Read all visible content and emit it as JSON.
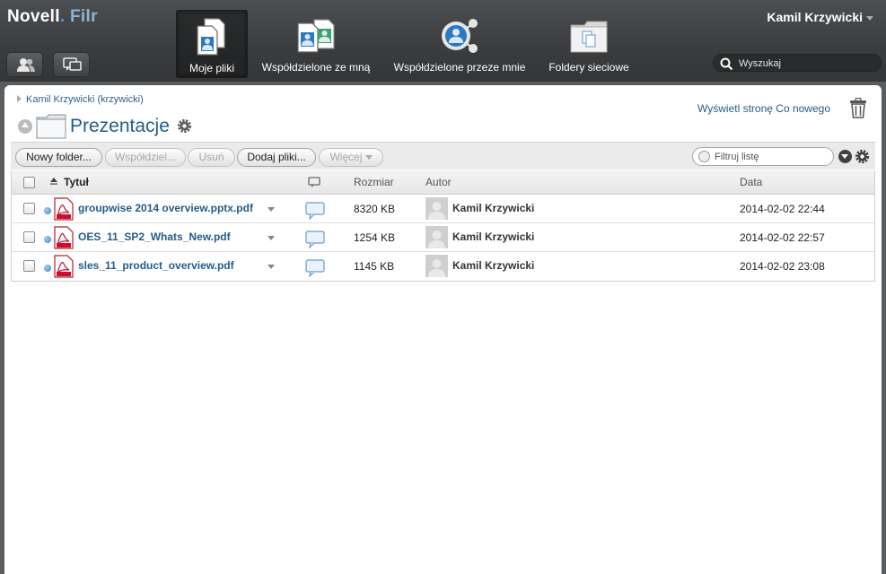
{
  "app": {
    "brand": "Novell",
    "brand_product": "Filr"
  },
  "user": {
    "name": "Kamil Krzywicki"
  },
  "nav": {
    "tabs": [
      {
        "label": "Moje pliki",
        "active": true
      },
      {
        "label": "Współdzielone ze mną",
        "active": false
      },
      {
        "label": "Współdzielone przeze mnie",
        "active": false
      },
      {
        "label": "Foldery sieciowe",
        "active": false
      }
    ]
  },
  "search": {
    "placeholder": "Wyszukaj"
  },
  "breadcrumb": {
    "label": "Kamil Krzywicki (krzywicki)"
  },
  "folder": {
    "title": "Prezentacje"
  },
  "whats_new_label": "Wyświetl stronę Co nowego",
  "toolbar": {
    "new_folder": "Nowy folder...",
    "share": "Współdziel...",
    "delete": "Usuń",
    "add_files": "Dodaj pliki...",
    "more": "Więcej"
  },
  "filter": {
    "placeholder": "Filtruj listę"
  },
  "table": {
    "headers": {
      "title": "Tytuł",
      "size": "Rozmiar",
      "author": "Autor",
      "date": "Data"
    },
    "rows": [
      {
        "name": "groupwise 2014 overview.pptx.pdf",
        "size": "8320 KB",
        "author": "Kamil Krzywicki",
        "date": "2014-02-02 22:44"
      },
      {
        "name": "OES_11_SP2_Whats_New.pdf",
        "size": "1254 KB",
        "author": "Kamil Krzywicki",
        "date": "2014-02-02 22:57"
      },
      {
        "name": "sles_11_product_overview.pdf",
        "size": "1145 KB",
        "author": "Kamil Krzywicki",
        "date": "2014-02-02 23:08"
      }
    ]
  },
  "colors": {
    "accent": "#245c8a",
    "topbar": "#3a3c3e",
    "presence": "#3b82c4",
    "pdf_red": "#c8102e"
  }
}
